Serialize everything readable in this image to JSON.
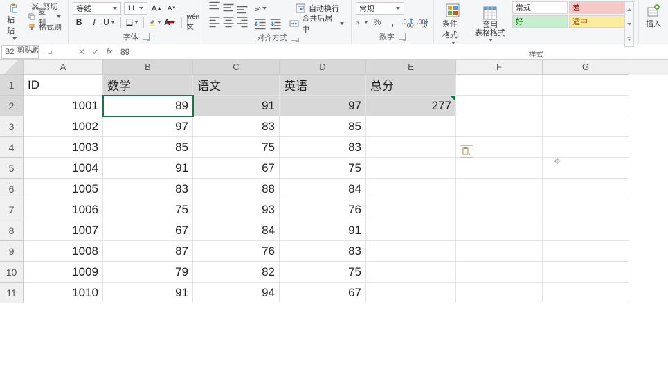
{
  "ribbon": {
    "clipboard": {
      "paste": "粘贴",
      "cut": "剪切",
      "copy": "复制",
      "painter": "格式刷",
      "group": "剪贴板"
    },
    "font": {
      "name": "等线",
      "size": "11",
      "group": "字体"
    },
    "alignment": {
      "wrap": "自动换行",
      "merge": "合并后居中",
      "group": "对齐方式"
    },
    "number": {
      "format": "常规",
      "group": "数字"
    },
    "styles": {
      "cond": "条件格式",
      "table": "套用\n表格格式",
      "normal": "常规",
      "bad": "差",
      "good": "好",
      "neutral": "适中",
      "group": "样式"
    },
    "insert": {
      "label": "插入"
    }
  },
  "namebar": {
    "ref": "B2",
    "formula": "89"
  },
  "columns": [
    "A",
    "B",
    "C",
    "D",
    "E",
    "F",
    "G"
  ],
  "rows": [
    {
      "n": 1,
      "ID": "ID",
      "B": "数学",
      "C": "语文",
      "D": "英语",
      "E": "总分"
    },
    {
      "n": 2,
      "ID": "1001",
      "B": "89",
      "C": "91",
      "D": "97",
      "E": "277"
    },
    {
      "n": 3,
      "ID": "1002",
      "B": "97",
      "C": "83",
      "D": "85",
      "E": ""
    },
    {
      "n": 4,
      "ID": "1003",
      "B": "85",
      "C": "75",
      "D": "83",
      "E": ""
    },
    {
      "n": 5,
      "ID": "1004",
      "B": "91",
      "C": "67",
      "D": "75",
      "E": ""
    },
    {
      "n": 6,
      "ID": "1005",
      "B": "83",
      "C": "88",
      "D": "84",
      "E": ""
    },
    {
      "n": 7,
      "ID": "1006",
      "B": "75",
      "C": "93",
      "D": "76",
      "E": ""
    },
    {
      "n": 8,
      "ID": "1007",
      "B": "67",
      "C": "84",
      "D": "91",
      "E": ""
    },
    {
      "n": 9,
      "ID": "1008",
      "B": "87",
      "C": "76",
      "D": "83",
      "E": ""
    },
    {
      "n": 10,
      "ID": "1009",
      "B": "79",
      "C": "82",
      "D": "75",
      "E": ""
    },
    {
      "n": 11,
      "ID": "1010",
      "B": "91",
      "C": "94",
      "D": "67",
      "E": ""
    }
  ],
  "chart_data": {
    "type": "table",
    "columns": [
      "ID",
      "数学",
      "语文",
      "英语",
      "总分"
    ],
    "rows": [
      [
        1001,
        89,
        91,
        97,
        277
      ],
      [
        1002,
        97,
        83,
        85,
        null
      ],
      [
        1003,
        85,
        75,
        83,
        null
      ],
      [
        1004,
        91,
        67,
        75,
        null
      ],
      [
        1005,
        83,
        88,
        84,
        null
      ],
      [
        1006,
        75,
        93,
        76,
        null
      ],
      [
        1007,
        67,
        84,
        91,
        null
      ],
      [
        1008,
        87,
        76,
        83,
        null
      ],
      [
        1009,
        79,
        82,
        75,
        null
      ],
      [
        1010,
        91,
        94,
        67,
        null
      ]
    ]
  }
}
